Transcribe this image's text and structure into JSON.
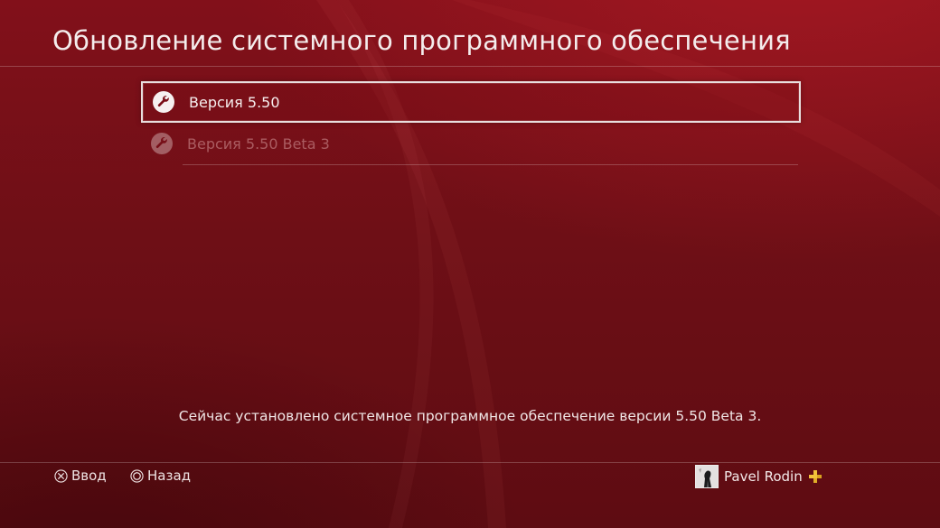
{
  "page": {
    "title": "Обновление системного программного обеспечения"
  },
  "menu": {
    "items": [
      {
        "label": "Версия 5.50",
        "icon": "wrench-icon",
        "selected": true
      },
      {
        "label": "Версия 5.50 Beta 3",
        "icon": "wrench-icon",
        "selected": false
      }
    ]
  },
  "status": {
    "text": "Сейчас установлено системное программное обеспечение версии 5.50 Beta 3."
  },
  "footer": {
    "enter_label": "Ввод",
    "enter_icon": "cross-button-icon",
    "back_label": "Назад",
    "back_icon": "circle-button-icon"
  },
  "user": {
    "name": "Pavel Rodin",
    "avatar_icon": "avatar-icon",
    "badge_icon": "ps-plus-icon",
    "badge_color": "#f2c23a"
  },
  "colors": {
    "background": "#6e0f16",
    "text": "#f3e6e6",
    "highlight_border": "#e9dede"
  }
}
